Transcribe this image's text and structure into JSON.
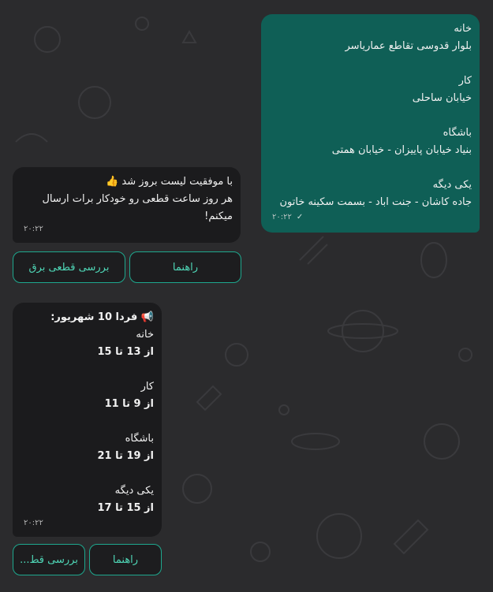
{
  "messages": {
    "sent": {
      "lines": [
        "خانه",
        "بلوار قدوسی تقاطع عمارياسر",
        "",
        "کار",
        "خیابان ساحلی",
        "",
        "باشگاه",
        "بنیاد خیابان پاییزان - خیابان همتی",
        "",
        "یکی دیگه",
        "جاده کاشان - جنت اباد - بسمت سکینه خاتون"
      ],
      "time": "۲۰:۲۲",
      "status_icon": "check-icon"
    },
    "update": {
      "line1_text": "با موفقیت لیست بروز شد",
      "line1_emoji": "👍",
      "line2": "هر روز ساعت قطعی رو خودکار برات ارسال",
      "line3": "میکنم!",
      "time": "۲۰:۲۲",
      "keyboard": {
        "guide": "راهنما",
        "check": "بررسی قطعی برق"
      }
    },
    "schedule": {
      "header_emoji": "📢",
      "header_text": "فردا 10 شهریور:",
      "items": [
        {
          "name": "خانه",
          "range": "از 13 تا 15"
        },
        {
          "name": "کار",
          "range": "از 9 تا 11"
        },
        {
          "name": "باشگاه",
          "range": "از 19 تا 21"
        },
        {
          "name": "یکی دیگه",
          "range": "از 15 تا 17"
        }
      ],
      "time": "۲۰:۲۲",
      "keyboard": {
        "guide": "راهنما",
        "check": "بررسی قط..."
      }
    }
  },
  "colors": {
    "background": "#2b2b2d",
    "sent_bubble": "#0f5f56",
    "received_bubble": "#1b1b1d",
    "button_border": "#1ea88e",
    "button_text": "#4fd7b7"
  }
}
